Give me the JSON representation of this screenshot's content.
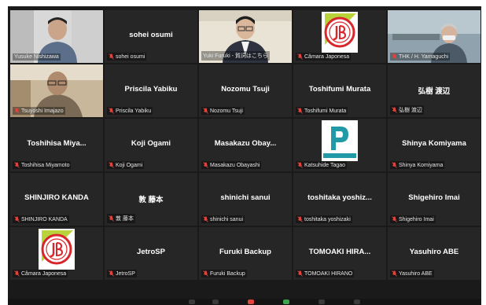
{
  "meeting": {
    "colors": {
      "background": "#1a1a1a",
      "tile": "#262626",
      "active_border": "#c8f000",
      "mute": "#e0443c"
    },
    "participants": [
      {
        "caption": "Yusuke Nishizawa",
        "center": "",
        "video": "person-desk",
        "muted": false
      },
      {
        "caption": "sohei osumi",
        "center": "sohei osumi",
        "video": "",
        "muted": true
      },
      {
        "caption": "Yuki Furuki - 賀詞はこちら",
        "center": "",
        "video": "person-glasses",
        "muted": false,
        "active": true
      },
      {
        "caption": "Câmara Japonesa",
        "center": "",
        "video": "logo-jb",
        "muted": true
      },
      {
        "caption": "THK / H. Yamaguchi",
        "center": "",
        "video": "person-window",
        "muted": true
      },
      {
        "caption": "Tsuyoshi Imajazo",
        "center": "",
        "video": "person-room",
        "muted": true
      },
      {
        "caption": "Priscila Yabiku",
        "center": "Priscila Yabiku",
        "video": "",
        "muted": true
      },
      {
        "caption": "Nozomu Tsuji",
        "center": "Nozomu Tsuji",
        "video": "",
        "muted": true
      },
      {
        "caption": "Toshifumi Murata",
        "center": "Toshifumi Murata",
        "video": "",
        "muted": true
      },
      {
        "caption": "弘樹 渡辺",
        "center": "弘樹 渡辺",
        "video": "",
        "muted": true
      },
      {
        "caption": "Toshihisa Miyamoto",
        "center": "Toshihisa Miya...",
        "video": "",
        "muted": true
      },
      {
        "caption": "Koji Ogami",
        "center": "Koji Ogami",
        "video": "",
        "muted": true
      },
      {
        "caption": "Masakazu Obayashi",
        "center": "Masakazu Obay...",
        "video": "",
        "muted": true
      },
      {
        "caption": "Katsuhide Tagao",
        "center": "",
        "video": "logo-panametric",
        "muted": true
      },
      {
        "caption": "Shinya Komiyama",
        "center": "Shinya Komiyama",
        "video": "",
        "muted": true
      },
      {
        "caption": "SHINJIRO KANDA",
        "center": "SHINJIRO KANDA",
        "video": "",
        "muted": true
      },
      {
        "caption": "敦 藤本",
        "center": "敦 藤本",
        "video": "",
        "muted": true
      },
      {
        "caption": "shinichi sanui",
        "center": "shinichi sanui",
        "video": "",
        "muted": true
      },
      {
        "caption": "toshitaka yoshizaki",
        "center": "toshitaka yoshiz...",
        "video": "",
        "muted": true
      },
      {
        "caption": "Shigehiro Imai",
        "center": "Shigehiro Imai",
        "video": "",
        "muted": true
      },
      {
        "caption": "Câmara Japonesa",
        "center": "",
        "video": "logo-jb",
        "muted": true
      },
      {
        "caption": "JetroSP",
        "center": "JetroSP",
        "video": "",
        "muted": true
      },
      {
        "caption": "Furuki Backup",
        "center": "Furuki Backup",
        "video": "",
        "muted": true
      },
      {
        "caption": "TOMOAKI HIRANO",
        "center": "TOMOAKI HIRA...",
        "video": "",
        "muted": true
      },
      {
        "caption": "Yasuhiro ABE",
        "center": "Yasuhiro ABE",
        "video": "",
        "muted": true
      }
    ]
  }
}
